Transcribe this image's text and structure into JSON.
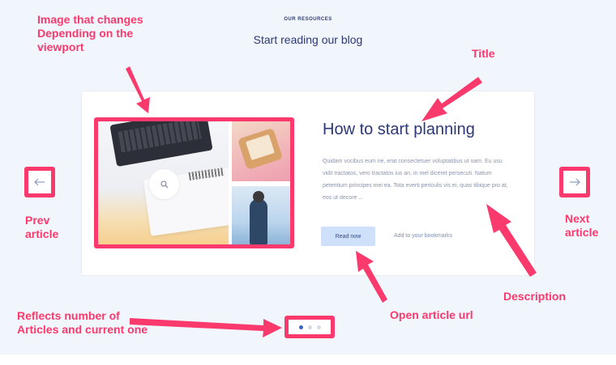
{
  "section": {
    "eyebrow": "OUR RESOURCES",
    "title": "Start reading our blog"
  },
  "article": {
    "title": "How to start planning",
    "description": "Quidam vocibus eum ne, erat consectetuer voluptatibus ut nam. Eu usu vidit tractatos, vero tractatos ius an, in mel diceret persecuti. Natum petentium principes mei ea. Tota everti periculis vis ei, quas tibique pro at, eos ut decore ...",
    "read_label": "Read now",
    "bookmark_label": "Add to your bookmarks"
  },
  "carousel": {
    "prev_icon": "arrow-left-icon",
    "next_icon": "arrow-right-icon",
    "dots": [
      {
        "active": true
      },
      {
        "active": false
      },
      {
        "active": false
      }
    ]
  },
  "annotations": {
    "image": "Image that changes Depending on the viewport",
    "title": "Title",
    "prev": "Prev article",
    "next": "Next article",
    "description": "Description",
    "open": "Open article url",
    "dots": "Reflects number of Articles and current one"
  },
  "colors": {
    "accent": "#fa3a6c",
    "primary_text": "#2c3878",
    "button_bg": "#cfe0fb"
  }
}
